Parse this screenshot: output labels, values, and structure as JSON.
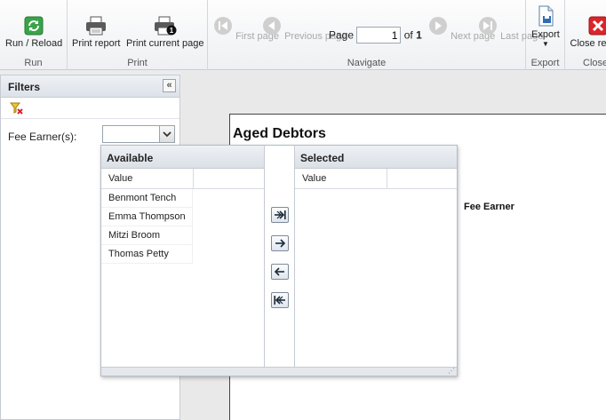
{
  "ribbon": {
    "groups": {
      "run": "Run",
      "print": "Print",
      "navigate": "Navigate",
      "export": "Export",
      "close": "Close"
    },
    "buttons": {
      "run_reload": "Run / Reload",
      "print_report": "Print report",
      "print_current_page": "Print current page",
      "first_page": "First page",
      "previous_page": "Previous page",
      "next_page": "Next page",
      "last_page": "Last page",
      "export": "Export",
      "close_report": "Close re"
    },
    "paging": {
      "page_label": "Page",
      "current_page": "1",
      "of_label": "of",
      "total_pages": "1"
    }
  },
  "filters": {
    "title": "Filters",
    "collapse_glyph": "«",
    "fee_earner_label": "Fee Earner(s):"
  },
  "dual_list": {
    "available_title": "Available",
    "selected_title": "Selected",
    "value_column": "Value",
    "available_items": [
      "Benmont Tench",
      "Emma Thompson",
      "Mitzi Broom",
      "Thomas Petty"
    ],
    "selected_items": []
  },
  "report": {
    "title": "Aged Debtors",
    "column_header": "Fee Earner"
  },
  "colors": {
    "run_icon": "#3aa34a",
    "close_icon": "#d9252b",
    "ribbon_bg": "#f3f5f8",
    "panel_header": "#dde2e9"
  }
}
